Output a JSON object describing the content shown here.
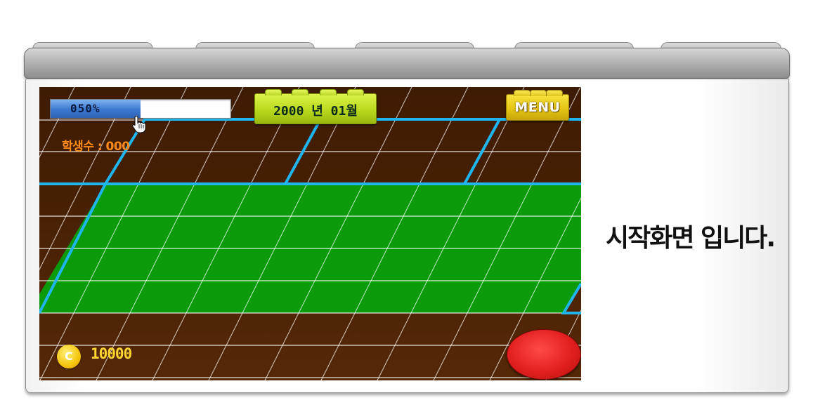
{
  "hud": {
    "progress_label": "050%",
    "progress_value": 0.5,
    "students_label": "학생수 : 000",
    "date_label": "2000 년 01월",
    "menu_label": "MENU",
    "coin_symbol": "C",
    "coins": "10000"
  },
  "side_text": "시작화면 입니다.",
  "colors": {
    "soil": "#4a2204",
    "field": "#0a9a0a",
    "grid_line": "#ffffff",
    "path": "#1fb6f0",
    "button": "#e21f1f"
  },
  "icons": {
    "cursor": "hand-pointer-icon",
    "coin": "coin-icon"
  }
}
